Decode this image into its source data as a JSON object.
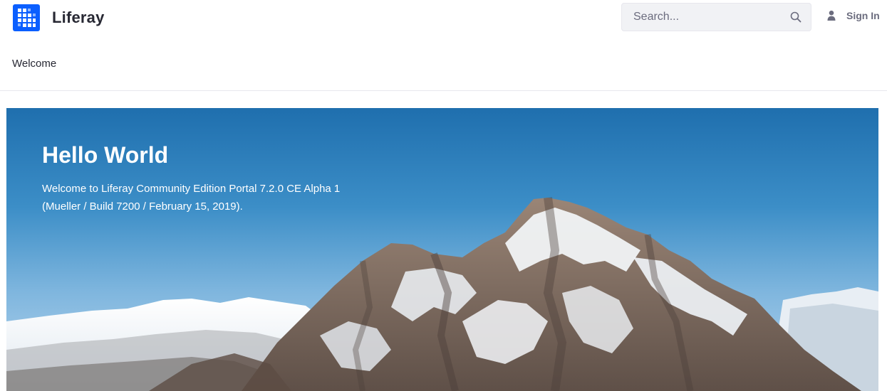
{
  "header": {
    "site_name": "Liferay",
    "search": {
      "placeholder": "Search...",
      "value": ""
    },
    "sign_in_label": "Sign In",
    "icons": {
      "logo": "liferay-logo-icon",
      "search": "search-icon",
      "user": "user-icon"
    }
  },
  "nav": {
    "items": [
      {
        "label": "Welcome"
      }
    ]
  },
  "hero": {
    "title": "Hello World",
    "text_line1": "Welcome to Liferay Community Edition Portal 7.2.0 CE Alpha 1",
    "text_line2": "(Mueller / Build 7200 / February 15, 2019)."
  },
  "colors": {
    "brand": "#0b5fff",
    "text": "#272833",
    "muted": "#6b6c7e",
    "search_bg": "#f1f2f5"
  }
}
